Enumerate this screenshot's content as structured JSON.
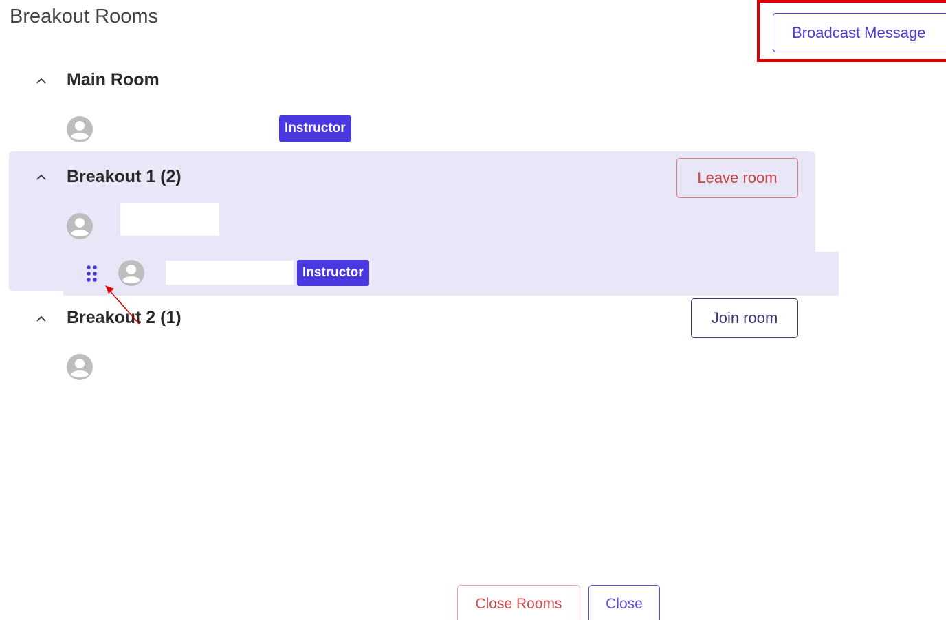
{
  "title": "Breakout Rooms",
  "broadcast_button": {
    "label": "Broadcast Message"
  },
  "rooms": [
    {
      "name": "Main Room",
      "participants": [
        {
          "name": "",
          "badge": "Instructor"
        }
      ]
    },
    {
      "name": "Breakout 1 (2)",
      "action_label": "Leave room",
      "participants": [
        {
          "name": ""
        },
        {
          "name": "",
          "badge": "Instructor",
          "drag_handle": "drag-handle-icon"
        }
      ]
    },
    {
      "name": "Breakout 2 (1)",
      "action_label": "Join room",
      "participants": [
        {
          "name": ""
        }
      ]
    }
  ],
  "footer": {
    "close_rooms_label": "Close Rooms",
    "close_label": "Close"
  },
  "colors": {
    "accent": "#4a38e0",
    "highlight": "#e00000",
    "danger": "#c94545",
    "active_room_bg": "#e9e6f8"
  }
}
